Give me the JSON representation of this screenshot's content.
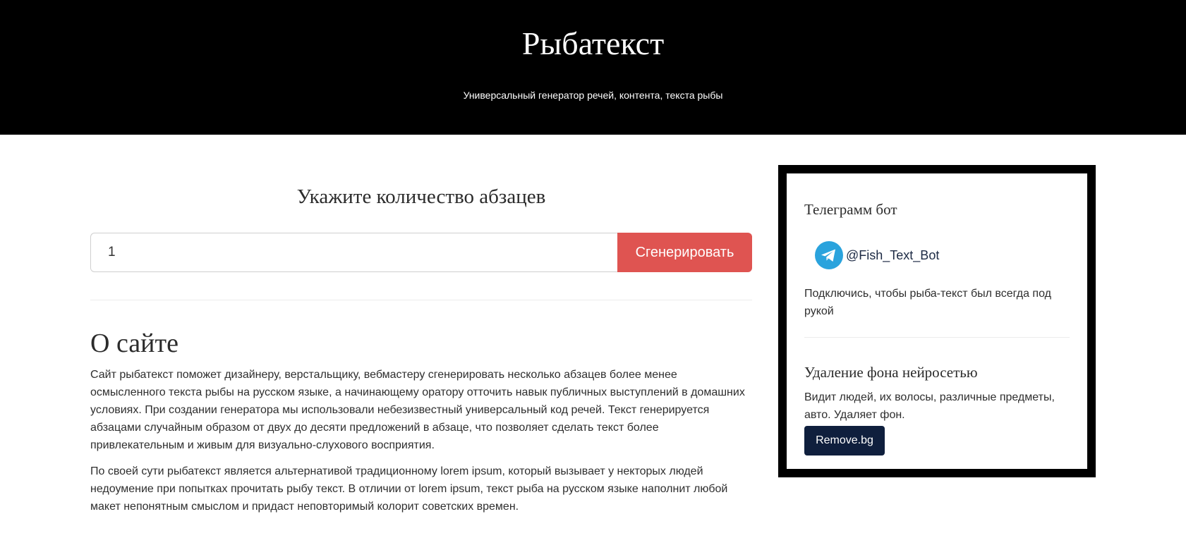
{
  "header": {
    "title": "Рыбатекст",
    "subtitle": "Универсальный генератор речей, контента, текста рыбы"
  },
  "generator": {
    "heading": "Укажите количество абзацев",
    "input_value": "1",
    "button_label": "Сгенерировать"
  },
  "about": {
    "heading": "О сайте",
    "paragraphs": [
      "Сайт рыбатекст поможет дизайнеру, верстальщику, вебмастеру сгенерировать несколько абзацев более менее осмысленного текста рыбы на русском языке, а начинающему оратору отточить навык публичных выступлений в домашних условиях. При создании генератора мы использовали небезизвестный универсальный код речей. Текст генерируется абзацами случайным образом от двух до десяти предложений в абзаце, что позволяет сделать текст более привлекательным и живым для визуально-слухового восприятия.",
      "По своей сути рыбатекст является альтернативой традиционному lorem ipsum, который вызывает у некторых людей недоумение при попытках прочитать рыбу текст. В отличии от lorem ipsum, текст рыба на русском языке наполнит любой макет непонятным смыслом и придаст неповторимый колорит советских времен."
    ]
  },
  "sidebar": {
    "telegram": {
      "title": "Телеграмм бот",
      "icon": "telegram-icon",
      "handle": "@Fish_Text_Bot",
      "description": "Подключись, чтобы рыба-текст был всегда под рукой"
    },
    "removebg": {
      "title": "Удаление фона нейросетью",
      "description": "Видит людей, их волосы, различные предметы, авто. Удаляет фон.",
      "button_label": "Remove.bg"
    }
  },
  "colors": {
    "header_bg": "#000000",
    "generate_button": "#df5451",
    "removebg_button": "#0f1f3d",
    "telegram_blue": "#2aa3dd"
  }
}
